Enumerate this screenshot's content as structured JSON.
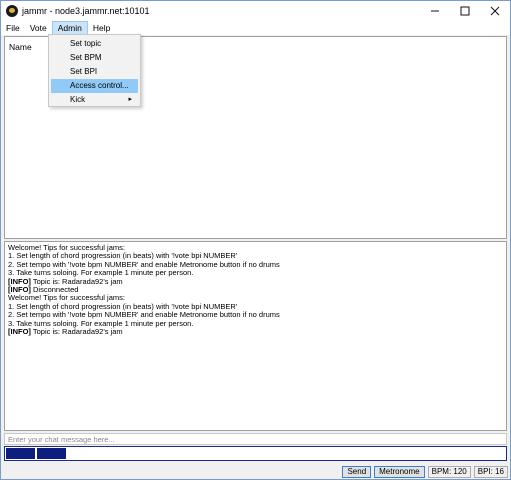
{
  "window": {
    "title": "jammr - node3.jammr.net:10101"
  },
  "menubar": {
    "items": [
      {
        "label": "File"
      },
      {
        "label": "Vote"
      },
      {
        "label": "Admin"
      },
      {
        "label": "Help"
      }
    ]
  },
  "admin_menu": {
    "items": [
      {
        "label": "Set topic"
      },
      {
        "label": "Set BPM"
      },
      {
        "label": "Set BPI"
      },
      {
        "label": "Access control..."
      },
      {
        "label": "Kick",
        "arrow": "▸"
      }
    ]
  },
  "users_panel": {
    "header": "Name"
  },
  "chat": {
    "lines": [
      {
        "tag": "",
        "text": "Welcome!  Tips for successful jams:"
      },
      {
        "tag": "",
        "text": "1. Set length of chord progression (in beats) with '!vote bpi NUMBER'"
      },
      {
        "tag": "",
        "text": "2. Set tempo with '!vote bpm NUMBER' and enable Metronome button if no drums"
      },
      {
        "tag": "",
        "text": "3. Take turns soloing.  For example 1 minute per person."
      },
      {
        "tag": "[INFO]",
        "text": " Topic is: Radarada92's jam"
      },
      {
        "tag": "[INFO]",
        "text": " Disconnected"
      },
      {
        "tag": "",
        "text": "Welcome!  Tips for successful jams:"
      },
      {
        "tag": "",
        "text": "1. Set length of chord progression (in beats) with '!vote bpi NUMBER'"
      },
      {
        "tag": "",
        "text": "2. Set tempo with '!vote bpm NUMBER' and enable Metronome button if no drums"
      },
      {
        "tag": "",
        "text": "3. Take turns soloing.  For example 1 minute per person."
      },
      {
        "tag": "[INFO]",
        "text": " Topic is: Radarada92's jam"
      }
    ],
    "input_placeholder": "Enter your chat message here..."
  },
  "status": {
    "send_label": "Send",
    "metronome_label": "Metronome",
    "bpm_label": "BPM: 120",
    "bpi_label": "BPI: 16"
  },
  "colors": {
    "channel_fill": "#0e1e7e",
    "menu_highlight": "#91c9f7"
  }
}
